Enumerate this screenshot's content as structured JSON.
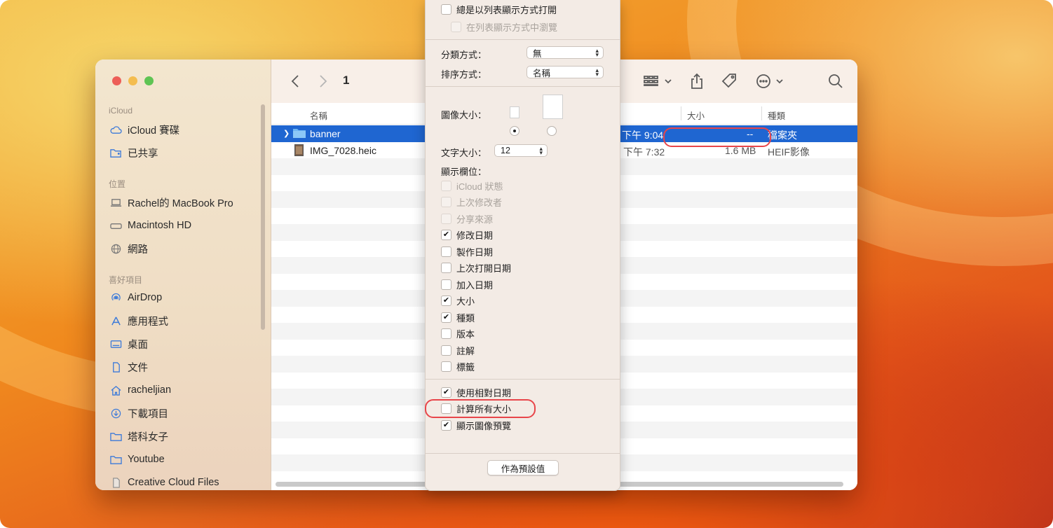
{
  "window": {
    "folder_title": "1"
  },
  "sidebar": {
    "sections": {
      "icloud": "iCloud",
      "locations": "位置",
      "favorites": "喜好項目"
    },
    "items": [
      {
        "label": "iCloud 賽碟",
        "icon": "cloud-icon"
      },
      {
        "label": "已共享",
        "icon": "shared-folder-icon"
      },
      {
        "label": "Rachel的 MacBook Pro",
        "icon": "laptop-icon"
      },
      {
        "label": "Macintosh HD",
        "icon": "disk-icon"
      },
      {
        "label": "網路",
        "icon": "globe-icon"
      },
      {
        "label": "AirDrop",
        "icon": "airdrop-icon"
      },
      {
        "label": "應用程式",
        "icon": "applications-icon"
      },
      {
        "label": "桌面",
        "icon": "desktop-icon"
      },
      {
        "label": "文件",
        "icon": "document-icon"
      },
      {
        "label": "racheljian",
        "icon": "home-icon"
      },
      {
        "label": "下載項目",
        "icon": "download-icon"
      },
      {
        "label": "塔科女子",
        "icon": "folder-icon"
      },
      {
        "label": "Youtube",
        "icon": "folder-icon"
      },
      {
        "label": "Creative Cloud Files",
        "icon": "file-icon"
      }
    ]
  },
  "columns": {
    "name": "名稱",
    "size": "大小",
    "kind": "種類"
  },
  "files": [
    {
      "name": "banner",
      "date": "下午 9:04",
      "size": "--",
      "kind": "檔案夾",
      "selected": true
    },
    {
      "name": "IMG_7028.heic",
      "date": "下午 7:32",
      "size": "1.6 MB",
      "kind": "HEIF影像",
      "selected": false
    }
  ],
  "view_options": {
    "always_open_list": "總是以列表顯示方式打開",
    "browse_in_list": "在列表顯示方式中瀏覽",
    "group_by_label": "分類方式：",
    "group_by_value": "無",
    "sort_by_label": "排序方式：",
    "sort_by_value": "名稱",
    "icon_size_label": "圖像大小：",
    "text_size_label": "文字大小：",
    "text_size_value": "12",
    "show_columns_label": "顯示欄位：",
    "columns": [
      {
        "label": "iCloud 狀態",
        "checked": false,
        "disabled": true
      },
      {
        "label": "上次修改者",
        "checked": false,
        "disabled": true
      },
      {
        "label": "分享來源",
        "checked": false,
        "disabled": true
      },
      {
        "label": "修改日期",
        "checked": true,
        "disabled": false
      },
      {
        "label": "製作日期",
        "checked": false,
        "disabled": false
      },
      {
        "label": "上次打開日期",
        "checked": false,
        "disabled": false
      },
      {
        "label": "加入日期",
        "checked": false,
        "disabled": false
      },
      {
        "label": "大小",
        "checked": true,
        "disabled": false
      },
      {
        "label": "種類",
        "checked": true,
        "disabled": false
      },
      {
        "label": "版本",
        "checked": false,
        "disabled": false
      },
      {
        "label": "註解",
        "checked": false,
        "disabled": false
      },
      {
        "label": "標籤",
        "checked": false,
        "disabled": false
      }
    ],
    "options": [
      {
        "label": "使用相對日期",
        "checked": true
      },
      {
        "label": "計算所有大小",
        "checked": false
      },
      {
        "label": "顯示圖像預覽",
        "checked": true
      }
    ],
    "use_defaults": "作為預設值"
  },
  "colors": {
    "selection": "#1f66d1",
    "highlight": "#e8454a"
  }
}
